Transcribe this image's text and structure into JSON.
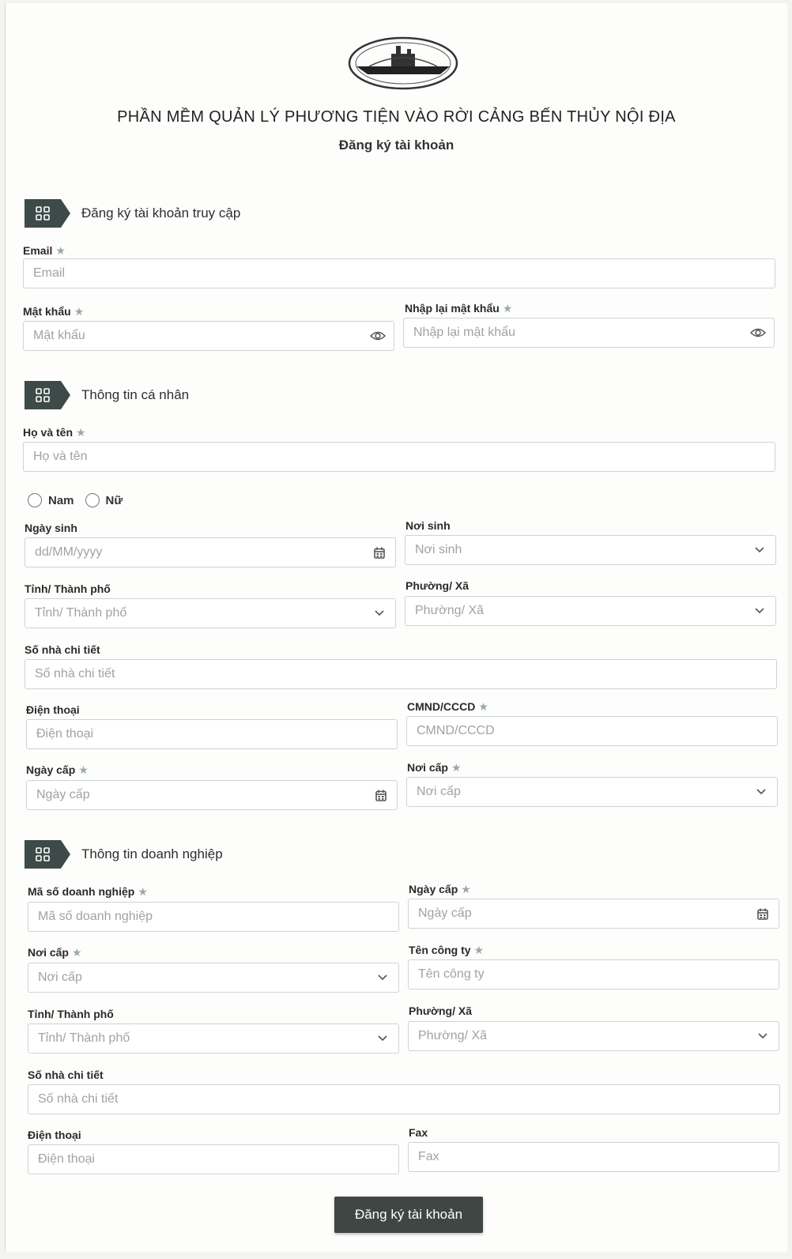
{
  "header": {
    "title": "PHẦN MỀM QUẢN LÝ PHƯƠNG TIỆN VÀO RỜI CẢNG BẾN THỦY NỘI ĐỊA",
    "subtitle": "Đăng ký tài khoản"
  },
  "required_mark": "★",
  "section_icon": "grid-icon",
  "account": {
    "title": "Đăng ký tài khoản truy cập",
    "email_label": "Email",
    "email_placeholder": "Email",
    "password_label": "Mật khẩu",
    "password_placeholder": "Mật khẩu",
    "confirm_label": "Nhập lại mật khẩu",
    "confirm_placeholder": "Nhập lại mật khẩu",
    "eye_icon": "eye-icon"
  },
  "personal": {
    "title": "Thông tin cá nhân",
    "fullname_label": "Họ và tên",
    "fullname_placeholder": "Họ và tên",
    "gender_male": "Nam",
    "gender_female": "Nữ",
    "dob_label": "Ngày sinh",
    "dob_placeholder": "dd/MM/yyyy",
    "birthplace_label": "Nơi sinh",
    "birthplace_placeholder": "Nơi sinh",
    "province_label": "Tỉnh/ Thành phố",
    "province_placeholder": "Tỉnh/ Thành phố",
    "ward_label": "Phường/ Xã",
    "ward_placeholder": "Phường/ Xã",
    "address_label": "Số nhà chi tiết",
    "address_placeholder": "Số nhà chi tiết",
    "phone_label": "Điện thoại",
    "phone_placeholder": "Điện thoại",
    "id_label": "CMND/CCCD",
    "id_placeholder": "CMND/CCCD",
    "issue_date_label": "Ngày cấp",
    "issue_date_placeholder": "Ngày cấp",
    "issue_place_label": "Nơi cấp",
    "issue_place_placeholder": "Nơi cấp"
  },
  "business": {
    "title": "Thông tin doanh nghiệp",
    "tax_label": "Mã số doanh nghiệp",
    "tax_placeholder": "Mã số doanh nghiệp",
    "issue_date_label": "Ngày cấp",
    "issue_date_placeholder": "Ngày cấp",
    "issue_place_label": "Nơi cấp",
    "issue_place_placeholder": "Nơi cấp",
    "company_label": "Tên công ty",
    "company_placeholder": "Tên công ty",
    "province_label": "Tỉnh/ Thành phố",
    "province_placeholder": "Tỉnh/ Thành phố",
    "ward_label": "Phường/ Xã",
    "ward_placeholder": "Phường/ Xã",
    "address_label": "Số nhà chi tiết",
    "address_placeholder": "Số nhà chi tiết",
    "phone_label": "Điện thoại",
    "phone_placeholder": "Điện thoại",
    "fax_label": "Fax",
    "fax_placeholder": "Fax"
  },
  "submit_label": "Đăng ký tài khoản",
  "colors": {
    "section_badge": "#3d4a48",
    "button": "#3f4644",
    "border": "#cfd3d6",
    "placeholder": "#9ea3a7"
  }
}
